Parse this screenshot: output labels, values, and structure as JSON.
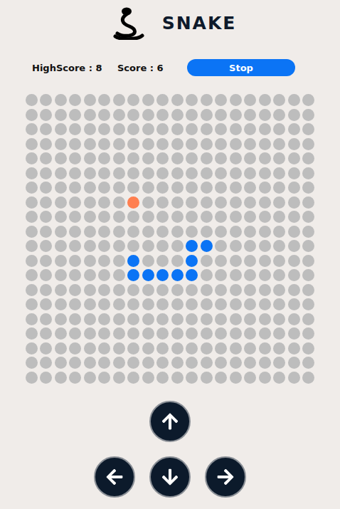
{
  "header": {
    "title": "SNAKE"
  },
  "scores": [
    {
      "text": "HighScore : 8"
    },
    {
      "text": "Score : 6"
    }
  ],
  "stop_button": {
    "label": "Stop"
  },
  "board": {
    "rows": 20,
    "cols": 20,
    "food": {
      "row": 7,
      "col": 7
    },
    "snake": [
      {
        "row": 10,
        "col": 11
      },
      {
        "row": 10,
        "col": 12
      },
      {
        "row": 11,
        "col": 7
      },
      {
        "row": 11,
        "col": 11
      },
      {
        "row": 12,
        "col": 7
      },
      {
        "row": 12,
        "col": 8
      },
      {
        "row": 12,
        "col": 9
      },
      {
        "row": 12,
        "col": 10
      },
      {
        "row": 12,
        "col": 11
      }
    ]
  }
}
